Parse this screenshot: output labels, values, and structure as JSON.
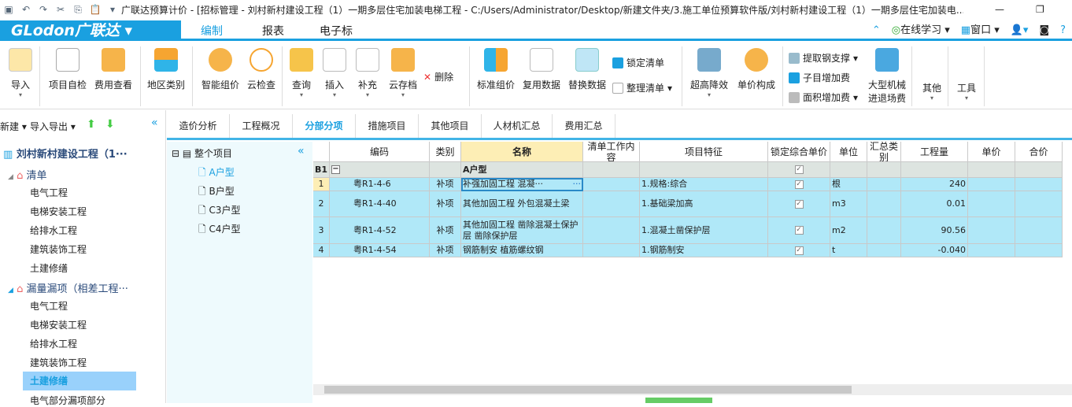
{
  "titlebar": {
    "title": "广联达预算计价 - [招标管理 - 刘村新村建设工程（1）一期多层住宅加装电梯工程 - C:/Users/Administrator/Desktop/新建文件夹/3.施工单位预算软件版/刘村新村建设工程（1）一期多层住宅加装电..."
  },
  "brand": {
    "name": "GLodon广联达"
  },
  "menu_tabs": [
    "编制",
    "报表",
    "电子标"
  ],
  "right_menu": {
    "learn": "在线学习",
    "window": "窗口",
    "help": "?"
  },
  "ribbon": {
    "import": "导入",
    "self_check": "项目自检",
    "fee_view": "费用查看",
    "region": "地区类别",
    "smart_price": "智能组价",
    "cloud_check": "云检查",
    "query": "查询",
    "insert": "插入",
    "supplement": "补充",
    "cloud_save": "云存档",
    "delete": "删除",
    "std_price": "标准组价",
    "reuse": "复用数据",
    "replace": "替换数据",
    "lock_list": "锁定清单",
    "sort_list": "整理清单",
    "super_high": "超高降效",
    "unit_price": "单价构成",
    "steel": "提取钢支撑",
    "sub_fee": "子目增加费",
    "area_fee": "面积增加费",
    "machine1": "大型机械",
    "machine2": "进退场费",
    "other": "其他",
    "tools": "工具"
  },
  "left": {
    "new": "新建",
    "import_export": "导入导出",
    "project": "刘村新村建设工程（1···",
    "groups": [
      {
        "name": "清单",
        "items": [
          "电气工程",
          "电梯安装工程",
          "给排水工程",
          "建筑装饰工程",
          "土建修缮"
        ]
      },
      {
        "name": "漏量漏项（相差工程···",
        "items": [
          "电气工程",
          "电梯安装工程",
          "给排水工程",
          "建筑装饰工程",
          "土建修缮",
          "电气部分漏项部分"
        ]
      }
    ]
  },
  "tabs": [
    "造价分析",
    "工程概况",
    "分部分项",
    "措施项目",
    "其他项目",
    "人材机汇总",
    "费用汇总"
  ],
  "tree": {
    "root": "整个项目",
    "items": [
      "A户型",
      "B户型",
      "C3户型",
      "C4户型"
    ]
  },
  "grid": {
    "headers": [
      "",
      "编码",
      "类别",
      "名称",
      "清单工作内容",
      "项目特征",
      "锁定综合单价",
      "单位",
      "汇总类别",
      "工程量",
      "单价",
      "合价"
    ],
    "group": {
      "no": "B1",
      "name": "A户型"
    },
    "rows": [
      {
        "no": "1",
        "code": "粤R1-4-6",
        "type": "补项",
        "name": "补强加固工程 混凝···",
        "feature": "1.规格:综合",
        "unit": "根",
        "qty": "240"
      },
      {
        "no": "2",
        "code": "粤R1-4-40",
        "type": "补项",
        "name": "其他加固工程 外包混凝土梁",
        "feature": "1.基础梁加高",
        "unit": "m3",
        "qty": "0.01"
      },
      {
        "no": "3",
        "code": "粤R1-4-52",
        "type": "补项",
        "name": "其他加固工程 凿除混凝土保护层 凿除保护层",
        "feature": "1.混凝土凿保护层",
        "unit": "m2",
        "qty": "90.56"
      },
      {
        "no": "4",
        "code": "粤R1-4-54",
        "type": "补项",
        "name": "钢筋制安 植筋螺纹钢",
        "feature": "1.钢筋制安",
        "unit": "t",
        "qty": "-0.040"
      }
    ]
  },
  "colors": {
    "accent": "#1aa0e0",
    "row_bg": "#b0e8f8",
    "group_bg": "#dde4e0",
    "header_sel": "#fdeeb5"
  }
}
